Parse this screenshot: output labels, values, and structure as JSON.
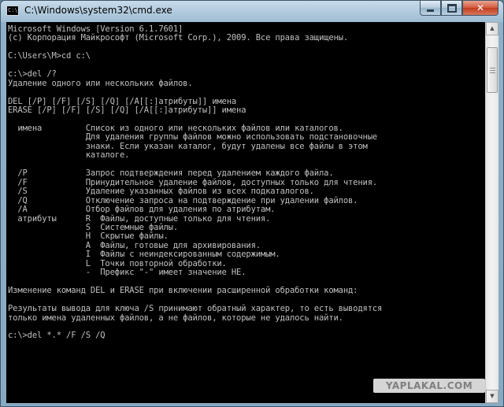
{
  "window": {
    "title": "C:\\Windows\\system32\\cmd.exe",
    "icon": "C:\\"
  },
  "console": {
    "lines": [
      "Microsoft Windows [Version 6.1.7601]",
      "(c) Корпорация Майкрософт (Microsoft Corp.), 2009. Все права защищены.",
      "",
      "C:\\Users\\M>cd c:\\",
      "",
      "c:\\>del /?",
      "Удаление одного или нескольких файлов.",
      "",
      "DEL [/P] [/F] [/S] [/Q] [/A[[:]атрибуты]] имена",
      "ERASE [/P] [/F] [/S] [/Q] [/A[[:]атрибуты]] имена",
      "",
      "  имена         Список из одного или нескольких файлов или каталогов.",
      "                Для удаления группы файлов можно использовать подстановочные",
      "                знаки. Если указан каталог, будут удалены все файлы в этом",
      "                каталоге.",
      "",
      "  /P            Запрос подтверждения перед удалением каждого файла.",
      "  /F            Принудительное удаление файлов, доступных только для чтения.",
      "  /S            Удаление указанных файлов из всех подкаталогов.",
      "  /Q            Отключение запроса на подтверждение при удалении файлов.",
      "  /A            Отбор файлов для удаления по атрибутам.",
      "  атрибуты      R  Файлы, доступные только для чтения.",
      "                S  Системные файлы.",
      "                H  Скрытые файлы.",
      "                A  Файлы, готовые для архивирования.",
      "                I  Файлы с неиндексированным содержимым.",
      "                L  Точки повторной обработки.",
      "                -  Префикс \"-\" имеет значение НЕ.",
      "",
      "Изменение команд DEL и ERASE при включении расширенной обработки команд:",
      "",
      "Результаты вывода для ключа /S принимают обратный характер, то есть выводятся",
      "только имена удаленных файлов, а не файлов, которые не удалось найти.",
      "",
      "c:\\>del *.* /F /S /Q"
    ]
  },
  "watermark": "YAPLAKAL.COM",
  "colors": {
    "console_bg": "#000000",
    "console_fg": "#c0c0c0",
    "close_button": "#c8472b",
    "titlebar": "#aac3d6"
  }
}
